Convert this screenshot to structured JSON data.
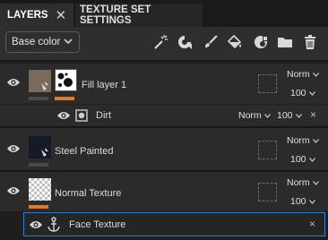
{
  "tabs": {
    "layers": "LAYERS",
    "layers_close": "✕",
    "texture_set_settings": "TEXTURE SET SETTINGS"
  },
  "toolbar": {
    "channel": "Base color",
    "icons": [
      "magic-wand-icon",
      "fill-effect-icon",
      "paint-brush-icon",
      "paint-bucket-icon",
      "mask-icon",
      "folder-icon",
      "trash-icon"
    ]
  },
  "layers": [
    {
      "name": "Fill layer 1",
      "blend": "Norm",
      "opacity": "100",
      "label_color": "#e87722",
      "thumb_color": "#7a6a5c",
      "sublayer": {
        "name": "Dirt",
        "blend": "Norm",
        "opacity": "100",
        "close": "×"
      }
    },
    {
      "name": "Steel Painted",
      "blend": "Norm",
      "opacity": "100",
      "label_color": "#4a4a4a",
      "thumb_color": "#141a28"
    },
    {
      "name": "Normal Texture",
      "blend": "Norm",
      "opacity": "100",
      "label_color": "#e87722"
    },
    {
      "name": "Face Texture",
      "close": "×",
      "selected": true,
      "accent_color": "#2f7ecb"
    }
  ]
}
